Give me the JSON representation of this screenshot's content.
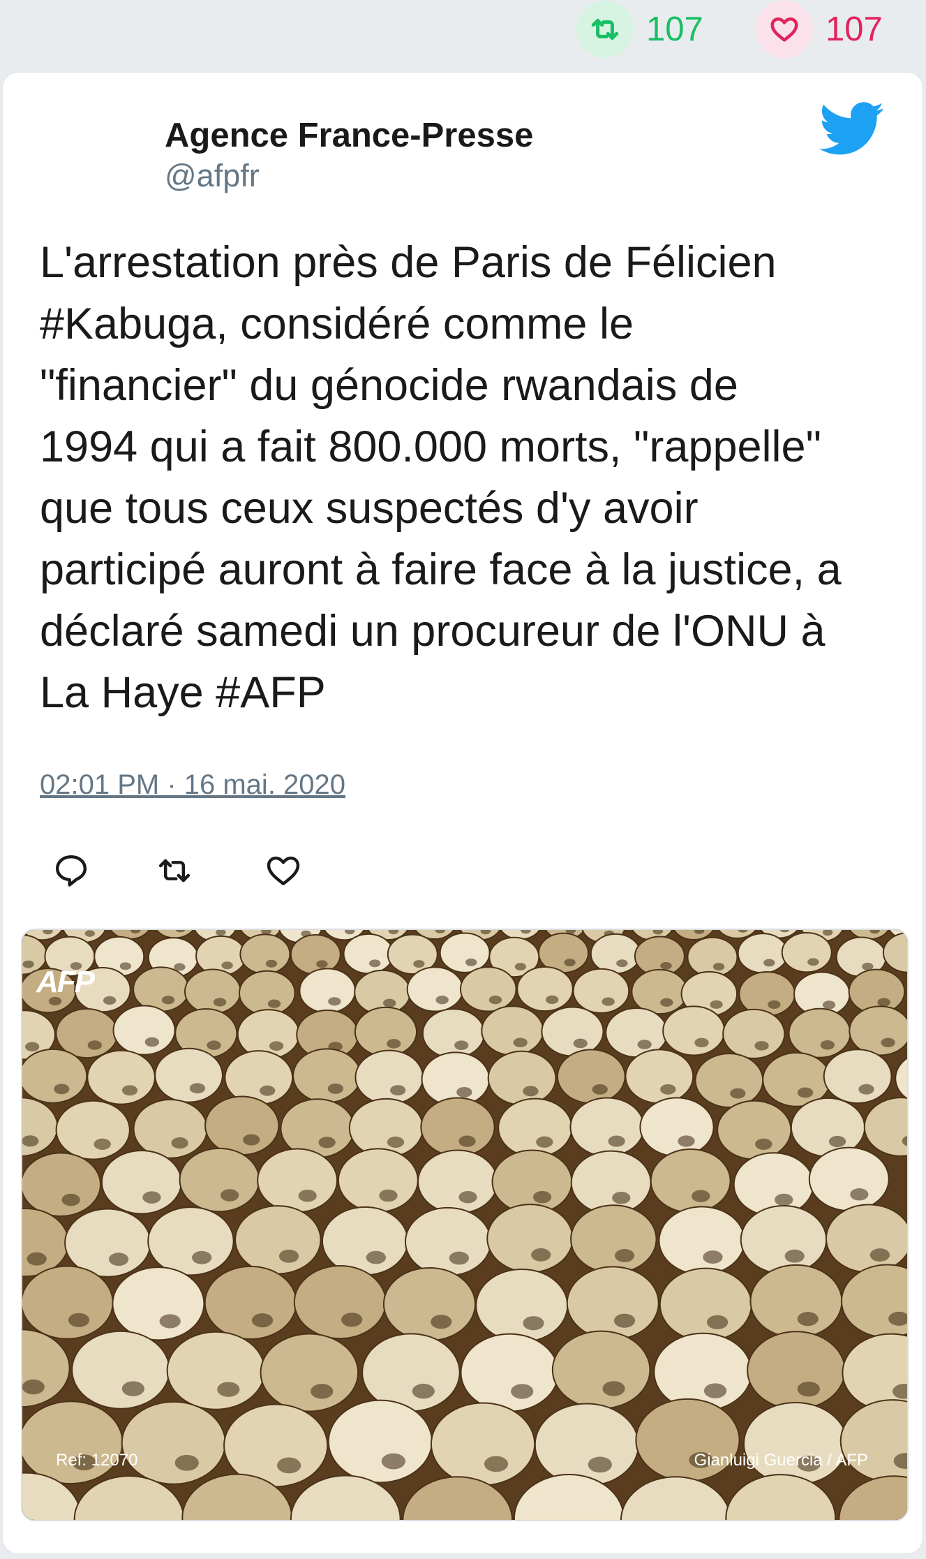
{
  "stats": {
    "retweets": "107",
    "likes": "107",
    "retweet_color": "#17bf63",
    "like_color": "#e0245e"
  },
  "author": {
    "name": "Agence France-Presse",
    "handle": "@afpfr"
  },
  "tweet": {
    "text": "L'arrestation près de Paris de Félicien\n#Kabuga, considéré comme le\n\"financier\" du génocide rwandais de\n1994 qui a fait 800.000 morts, \"rappelle\"\nque tous ceux suspectés d'y avoir\nparticipé auront à faire face à la justice, a\ndéclaré samedi un procureur de l'ONU à\nLa Haye #AFP",
    "timestamp": "02:01 PM · 16 mai. 2020"
  },
  "icons": {
    "brand": "twitter-bird-icon",
    "retweet": "retweet-icon",
    "like": "heart-icon",
    "reply": "reply-icon"
  },
  "photo": {
    "logo": "AFP",
    "ref": "Ref: 12070",
    "credit": "Gianluigi Guercia / AFP"
  }
}
